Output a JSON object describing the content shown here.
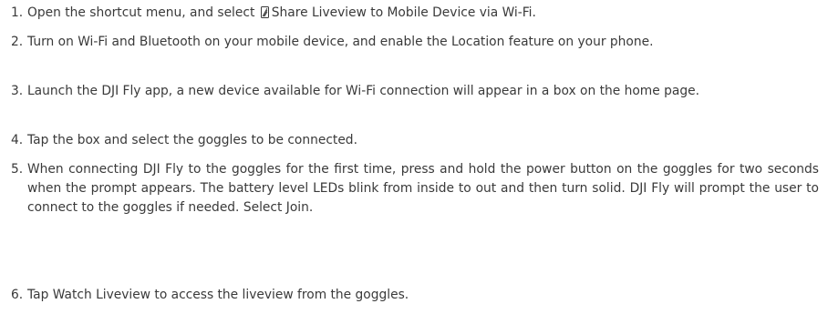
{
  "steps": [
    {
      "number": "1.",
      "text_before_icon": "Open the shortcut menu, and select ",
      "icon": "phone-share-icon",
      "text_after_icon": "Share Liveview to Mobile Device via Wi-Fi."
    },
    {
      "number": "2.",
      "text": "Turn on Wi-Fi and Bluetooth on your mobile device, and enable the Location feature on your phone."
    },
    {
      "number": "3.",
      "text": "Launch the DJI Fly app, a new device available for Wi-Fi connection will appear in a box on the home page."
    },
    {
      "number": "4.",
      "text": "Tap the box and select the goggles to be connected."
    },
    {
      "number": "5.",
      "text": "When connecting DJI Fly to the goggles for the first time, press and hold the power button on the goggles for two seconds when the prompt appears. The battery level LEDs  blink from inside to out and then turn solid. DJI Fly will prompt the user to connect to the goggles if needed. Select Join."
    },
    {
      "number": "6.",
      "text": "Tap Watch Liveview to access the liveview from the goggles."
    }
  ]
}
